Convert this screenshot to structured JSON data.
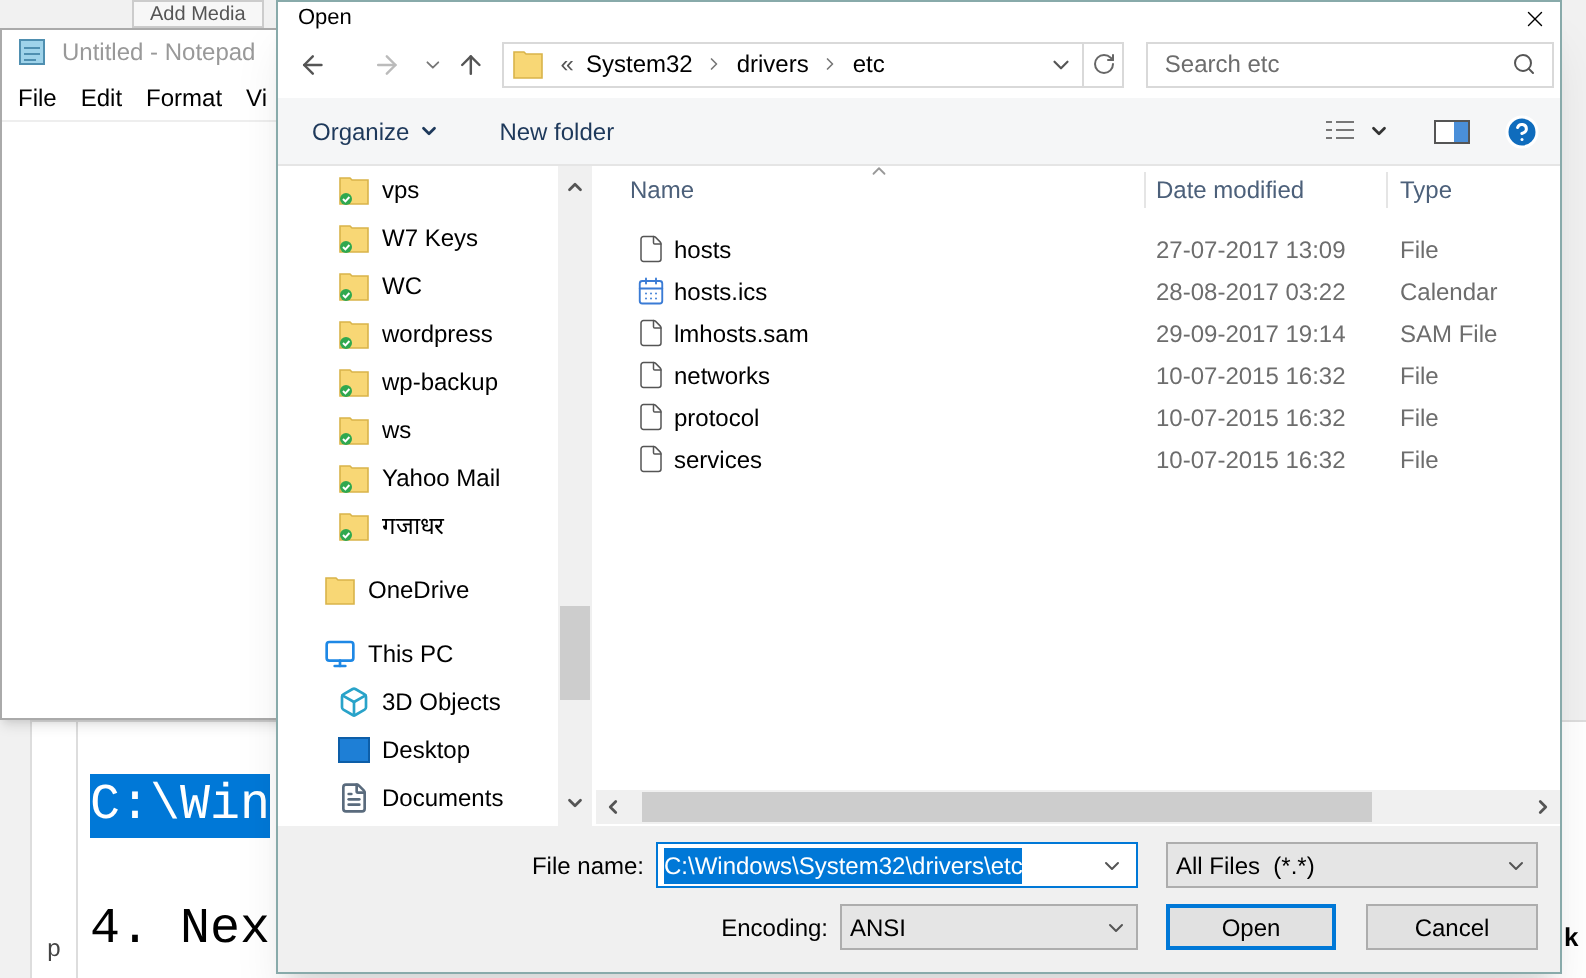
{
  "background_editor": {
    "add_media_button": "Add Media",
    "content_lines": [
      {
        "text": "C:\\Win",
        "selected": true
      },
      {
        "text": "4. Nex",
        "selected": false
      }
    ],
    "status_text": "p",
    "edge_text": "k"
  },
  "notepad": {
    "title": "Untitled - Notepad",
    "menu": [
      "File",
      "Edit",
      "Format",
      "Vi"
    ]
  },
  "dialog": {
    "title": "Open",
    "address": {
      "overflow": "«",
      "segments": [
        "System32",
        "drivers",
        "etc"
      ]
    },
    "search": {
      "placeholder": "Search etc"
    },
    "toolbar": {
      "organize": "Organize",
      "new_folder": "New folder"
    },
    "nav_pane": [
      {
        "label": "vps",
        "kind": "synced_folder"
      },
      {
        "label": "W7 Keys",
        "kind": "synced_folder"
      },
      {
        "label": "WC",
        "kind": "synced_folder"
      },
      {
        "label": "wordpress",
        "kind": "synced_folder"
      },
      {
        "label": "wp-backup",
        "kind": "synced_folder"
      },
      {
        "label": "ws",
        "kind": "synced_folder"
      },
      {
        "label": "Yahoo Mail",
        "kind": "synced_folder"
      },
      {
        "label": "गजाधर",
        "kind": "synced_folder"
      },
      {
        "label": "OneDrive",
        "kind": "folder"
      },
      {
        "label": "This PC",
        "kind": "pc",
        "children": [
          {
            "label": "3D Objects",
            "kind": "objects"
          },
          {
            "label": "Desktop",
            "kind": "desktop"
          },
          {
            "label": "Documents",
            "kind": "documents"
          }
        ]
      }
    ],
    "columns": [
      "Name",
      "Date modified",
      "Type"
    ],
    "rows": [
      {
        "name": "hosts",
        "date": "27-07-2017 13:09",
        "type": "File",
        "kind": "file"
      },
      {
        "name": "hosts.ics",
        "date": "28-08-2017 03:22",
        "type": "Calendar",
        "kind": "calendar"
      },
      {
        "name": "lmhosts.sam",
        "date": "29-09-2017 19:14",
        "type": "SAM File",
        "kind": "file"
      },
      {
        "name": "networks",
        "date": "10-07-2015 16:32",
        "type": "File",
        "kind": "file"
      },
      {
        "name": "protocol",
        "date": "10-07-2015 16:32",
        "type": "File",
        "kind": "file"
      },
      {
        "name": "services",
        "date": "10-07-2015 16:32",
        "type": "File",
        "kind": "file"
      }
    ],
    "file_name": {
      "label": "File name:",
      "value": "C:\\Windows\\System32\\drivers\\etc",
      "selected": true
    },
    "file_type": "All Files  (*.*)",
    "encoding": {
      "label": "Encoding:",
      "value": "ANSI"
    },
    "buttons": [
      {
        "label": "Open",
        "default": true
      },
      {
        "label": "Cancel",
        "default": false
      }
    ]
  }
}
